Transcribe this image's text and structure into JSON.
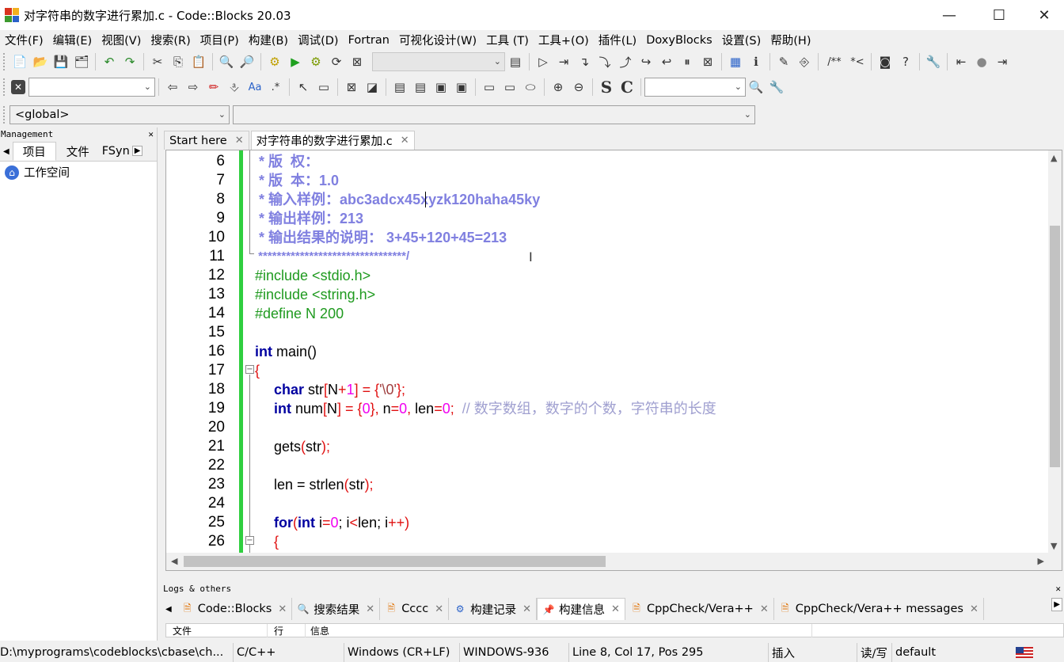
{
  "window": {
    "title": "对字符串的数字进行累加.c - Code::Blocks 20.03",
    "minimize": "—",
    "maximize": "☐",
    "close": "✕"
  },
  "menu": [
    "文件(F)",
    "编辑(E)",
    "视图(V)",
    "搜索(R)",
    "项目(P)",
    "构建(B)",
    "调试(D)",
    "Fortran",
    "可视化设计(W)",
    "工具 (T)",
    "工具+(O)",
    "插件(L)",
    "DoxyBlocks",
    "设置(S)",
    "帮助(H)"
  ],
  "scope": {
    "global": "<global>"
  },
  "management": {
    "title": "Management",
    "close": "✕",
    "tabs": [
      "项目",
      "文件",
      "FSyn"
    ],
    "workspace": "工作空间"
  },
  "editor": {
    "tabs": [
      {
        "label": "Start here",
        "close": "✕"
      },
      {
        "label": "对字符串的数字进行累加.c",
        "close": "✕"
      }
    ],
    "line_numbers": [
      "6",
      "7",
      "8",
      "9",
      "10",
      "11",
      "12",
      "13",
      "14",
      "15",
      "16",
      "17",
      "18",
      "19",
      "20",
      "21",
      "22",
      "23",
      "24",
      "25",
      "26"
    ],
    "code": {
      "l6": " * 版  权：",
      "l7": " * 版  本：1.0",
      "l8": " * 输入样例：abc3adcx45xyzk120haha45ky",
      "l9": " * 输出样例：213",
      "l10": " * 输出结果的说明： 3+45+120+45=213",
      "l11": " ********************************/",
      "l12": "#include <stdio.h>",
      "l13": "#include <string.h>",
      "l14": "#define N 200",
      "l16_kw": "int",
      "l16_rest": " main()",
      "l17": "{",
      "l18": {
        "kw": "char",
        "a": " str",
        "b": "[",
        "c": "N",
        "d": "+",
        "e": "1",
        "f": "] = {",
        "g": "'\\0'",
        "h": "};"
      },
      "l19": {
        "kw": "int",
        "a": " num",
        "b": "[",
        "c": "N",
        "d": "] = {",
        "e": "0",
        "f": "}, ",
        "g": "n",
        "h": "=",
        "i": "0",
        ", ": ", ",
        "j": "len",
        "k": "=",
        "l": "0",
        "m": ";",
        "cmt": "  // 数字数组，数字的个数，字符串的长度"
      },
      "l21": {
        "a": "gets",
        "b": "(",
        "c": "str",
        "d": ");"
      },
      "l23": {
        "a": "len = ",
        "b": "strlen",
        "c": "(",
        "d": "str",
        "e": ");"
      },
      "l25": {
        "kw": "for",
        "b": "(",
        "kw2": "int",
        "c": " i",
        "d": "=",
        "e": "0",
        "f": "; i",
        "g": "<",
        "h": "len",
        "i": "; i",
        "j": "++",
        ")": ")"
      },
      "l26": "{"
    }
  },
  "logs": {
    "title": "Logs & others",
    "close": "✕",
    "tabs": [
      {
        "label": "Code::Blocks",
        "close": "✕"
      },
      {
        "label": "搜索结果",
        "close": "✕"
      },
      {
        "label": "Cccc",
        "close": "✕"
      },
      {
        "label": "构建记录",
        "close": "✕"
      },
      {
        "label": "构建信息",
        "close": "✕"
      },
      {
        "label": "CppCheck/Vera++",
        "close": "✕"
      },
      {
        "label": "CppCheck/Vera++ messages",
        "close": "✕"
      }
    ],
    "columns": [
      "文件",
      "行",
      "信息"
    ]
  },
  "status": {
    "path": "D:\\myprograms\\codeblocks\\cbase\\ch...",
    "lang": "C/C++",
    "eol": "Windows (CR+LF)",
    "encoding": "WINDOWS-936",
    "position": "Line 8, Col 17, Pos 295",
    "mode": "插入",
    "access": "读/写",
    "profile": "default"
  },
  "colors": {
    "comment": "#8080e0",
    "preprocessor": "#1f9a1f",
    "keyword": "#0000a0",
    "number": "#f000f0",
    "operator": "#e01010",
    "change_bar": "#2fcf3f"
  }
}
